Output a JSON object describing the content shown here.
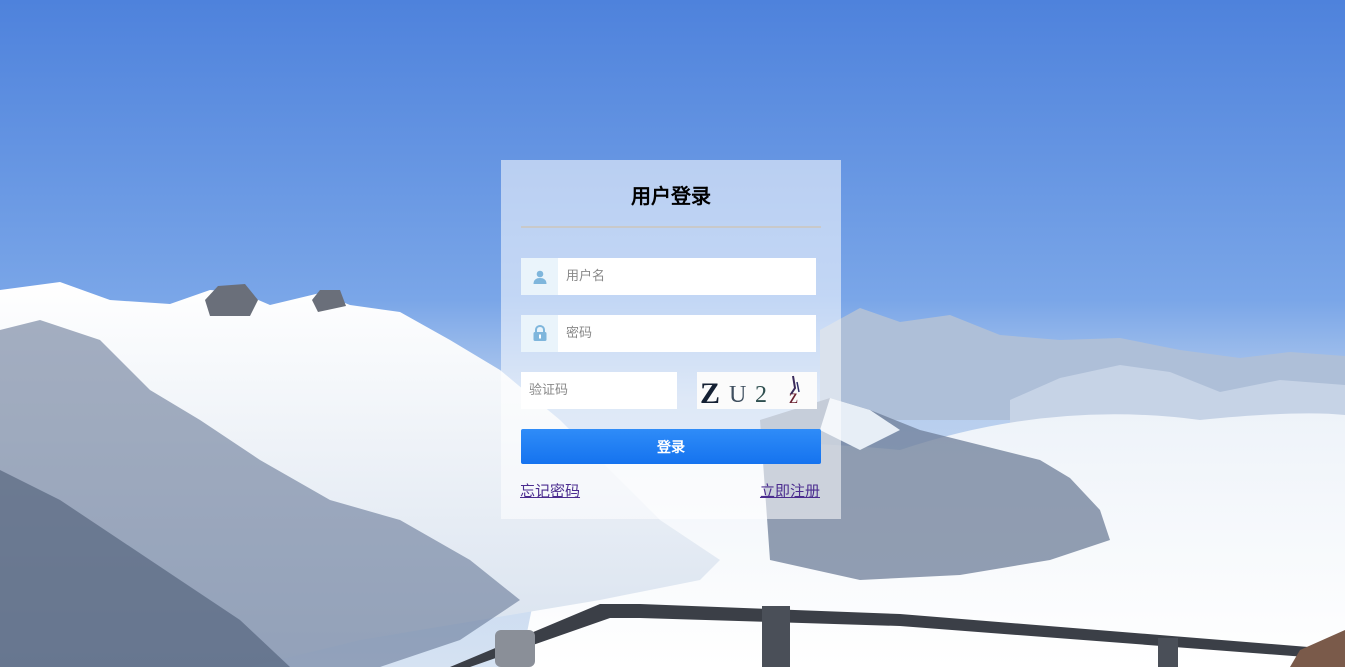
{
  "login": {
    "title": "用户登录",
    "username": {
      "placeholder": "用户名",
      "value": ""
    },
    "password": {
      "placeholder": "密码",
      "value": ""
    },
    "captcha": {
      "placeholder": "验证码",
      "value": "",
      "image_text": [
        "Z",
        "U",
        "2",
        "z"
      ]
    },
    "submit_label": "登录",
    "forgot_password_label": "忘记密码",
    "register_label": "立即注册"
  },
  "colors": {
    "button": "#1a7ef5",
    "icon_bg": "#eaf4fb",
    "icon": "#7fb6dc",
    "link": "#4b2c8f"
  },
  "icons": {
    "username": "user-icon",
    "password": "lock-icon"
  }
}
